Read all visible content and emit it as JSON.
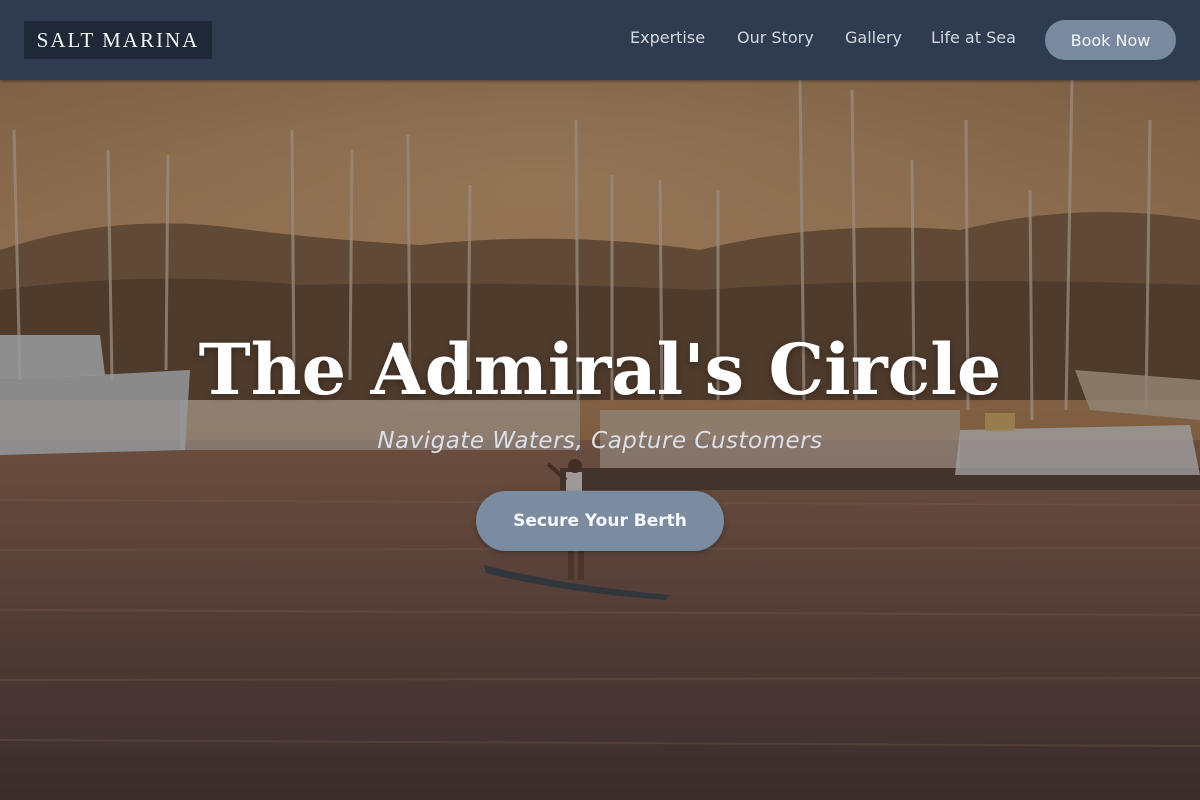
{
  "brand": {
    "name": "SALT MARINA"
  },
  "nav": {
    "items": [
      {
        "label": "Expertise"
      },
      {
        "label": "Our Story"
      },
      {
        "label": "Gallery"
      },
      {
        "label": "Life at Sea"
      }
    ],
    "cta_label": "Book Now"
  },
  "hero": {
    "title": "The Admiral's Circle",
    "tagline": "Navigate Waters, Capture Customers",
    "cta_label": "Secure Your Berth"
  },
  "colors": {
    "header_bg": "#2f3c50",
    "logo_bg": "#1f2836",
    "button_bg": "#7a8a9e"
  }
}
